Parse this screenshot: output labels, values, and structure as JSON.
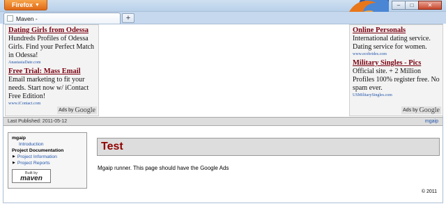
{
  "browser": {
    "menu_button": "Firefox",
    "tab_title": "Maven -",
    "new_tab": "+",
    "window_buttons": {
      "minimize": "–",
      "maximize": "□",
      "close": "✕"
    }
  },
  "ads_left": {
    "ads": [
      {
        "title": "Dating Girls from Odessa",
        "body": "Hundreds Profiles of Odessa Girls. Find your Perfect Match in Odessa!",
        "url": "AnastasiaDate.com"
      },
      {
        "title": "Free Trial: Mass Email",
        "body": "Email marketing to fit your needs. Start now w/ iContact Free Edition!",
        "url": "www.iContact.com"
      }
    ],
    "ads_by": "Ads by",
    "google": "Google"
  },
  "ads_right": {
    "ads": [
      {
        "title": "Online Personals",
        "body": "International dating service. Dating service for women.",
        "url": "www.ecobrides.com"
      },
      {
        "title": "Military Singles - Pics",
        "body": "Official site. + 2 Million Profiles 100% register free. No spam ever.",
        "url": "USMilitarySingles.com"
      }
    ],
    "ads_by": "Ads by",
    "google": "Google"
  },
  "banner": {
    "last_published": "Last Published: 2011-05-12",
    "right_link": "mgaip"
  },
  "nav": {
    "project_title": "mgaip",
    "introduction": "Introduction",
    "project_documentation": "Project Documentation",
    "project_information": "Project Information",
    "project_reports": "Project Reports",
    "built_by_small": "Built by",
    "built_by_maven": "maven"
  },
  "main": {
    "heading": "Test",
    "text": "Mgaip runner. This page should have the Google Ads"
  },
  "footer": {
    "copyright": "© 2011"
  }
}
